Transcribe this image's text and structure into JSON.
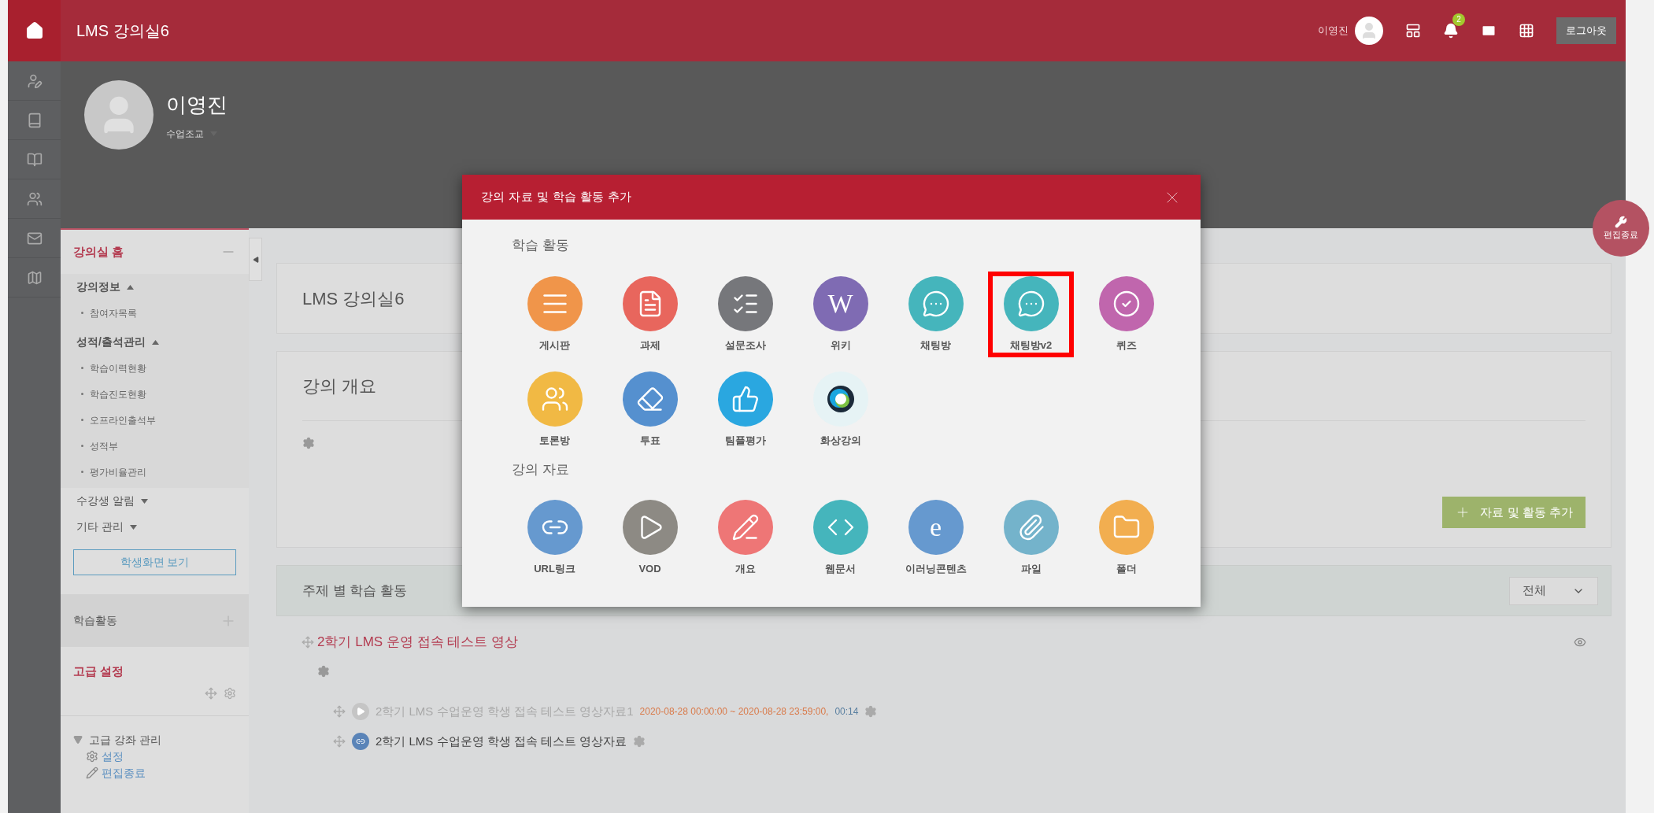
{
  "top_bar": {
    "course_title": "LMS 강의실6",
    "user_name": "이영진",
    "notification_count": "2",
    "logout": "로그아웃"
  },
  "profile": {
    "name": "이영진",
    "role": "수업조교"
  },
  "edit_end_button": "편집종료",
  "sidebar": {
    "home": {
      "title": "강의실 홈"
    },
    "groups": [
      {
        "label": "강의정보",
        "expanded": true,
        "children": [
          {
            "label": "참여자목록"
          }
        ]
      },
      {
        "label": "성적/출석관리",
        "expanded": true,
        "children": [
          {
            "label": "학습이력현황"
          },
          {
            "label": "학습진도현황"
          },
          {
            "label": "오프라인출석부"
          },
          {
            "label": "성적부"
          },
          {
            "label": "평가비율관리"
          }
        ]
      },
      {
        "label": "수강생 알림",
        "expanded": false
      },
      {
        "label": "기타 관리",
        "expanded": false
      }
    ],
    "student_view_button": "학생화면 보기",
    "activities_block": "학습활동",
    "advanced": {
      "title": "고급 설정",
      "tree_title": "고급 강좌 관리",
      "links": [
        {
          "kind": "gear",
          "label": "설정"
        },
        {
          "kind": "pencil",
          "label": "편집종료"
        }
      ]
    }
  },
  "content": {
    "course_card_title": "LMS 강의실6",
    "overview_title": "강의 개요",
    "add_button": "자료 및 활동 추가",
    "topics_title": "주제 별 학습 활동",
    "filter": "전체",
    "topic": {
      "title": "2학기 LMS 운영 접속 테스트 영상",
      "items": [
        {
          "kind": "vod",
          "title": "2학기 LMS 수업운영 학생 접속 테스트 영상자료1",
          "dates": "2020-08-28 00:00:00 ~ 2020-08-28 23:59:00,",
          "duration": "00:14",
          "dimmed": true
        },
        {
          "kind": "url",
          "title": "2학기 LMS 수업운영 학생 접속 테스트 영상자료",
          "dimmed": false
        }
      ]
    }
  },
  "modal": {
    "title": "강의 자료 및 학습 활동 추가",
    "sections": [
      {
        "title": "학습 활동",
        "items": [
          {
            "kind": "lines",
            "label": "게시판",
            "color": "#f0954a",
            "selected": false
          },
          {
            "kind": "document",
            "label": "과제",
            "color": "#e8665d",
            "selected": false
          },
          {
            "kind": "checklist",
            "label": "설문조사",
            "color": "#76777b",
            "selected": false
          },
          {
            "kind": "glyph",
            "glyph": "W",
            "label": "위키",
            "color": "#7f6bb3",
            "selected": false
          },
          {
            "kind": "chat",
            "label": "채팅방",
            "color": "#45b5bc",
            "selected": false
          },
          {
            "kind": "chat",
            "label": "채팅방v2",
            "color": "#45b5bc",
            "selected": true
          },
          {
            "kind": "check",
            "label": "퀴즈",
            "color": "#c066ad",
            "selected": false
          },
          {
            "kind": "people",
            "label": "토론방",
            "color": "#f1b944",
            "selected": false
          },
          {
            "kind": "eraser",
            "label": "투표",
            "color": "#5590cf",
            "selected": false
          },
          {
            "kind": "thumb",
            "label": "팀플평가",
            "color": "#2aa7e0",
            "selected": false
          },
          {
            "kind": "webex",
            "label": "화상강의",
            "color": "#e6f3f5",
            "selected": false
          }
        ]
      },
      {
        "title": "강의 자료",
        "items": [
          {
            "kind": "link",
            "label": "URL링크",
            "color": "#6699cf",
            "selected": false
          },
          {
            "kind": "play",
            "label": "VOD",
            "color": "#8d8a84",
            "selected": false
          },
          {
            "kind": "pencil",
            "label": "개요",
            "color": "#ee7676",
            "selected": false
          },
          {
            "kind": "code",
            "label": "웹문서",
            "color": "#45b5bc",
            "selected": false
          },
          {
            "kind": "glyph",
            "glyph": "e",
            "label": "이러닝콘텐츠",
            "color": "#6699cf",
            "selected": false
          },
          {
            "kind": "clip",
            "label": "파일",
            "color": "#74b3cb",
            "selected": false
          },
          {
            "kind": "folder",
            "label": "폴더",
            "color": "#f2ae50",
            "selected": false
          }
        ]
      }
    ]
  }
}
